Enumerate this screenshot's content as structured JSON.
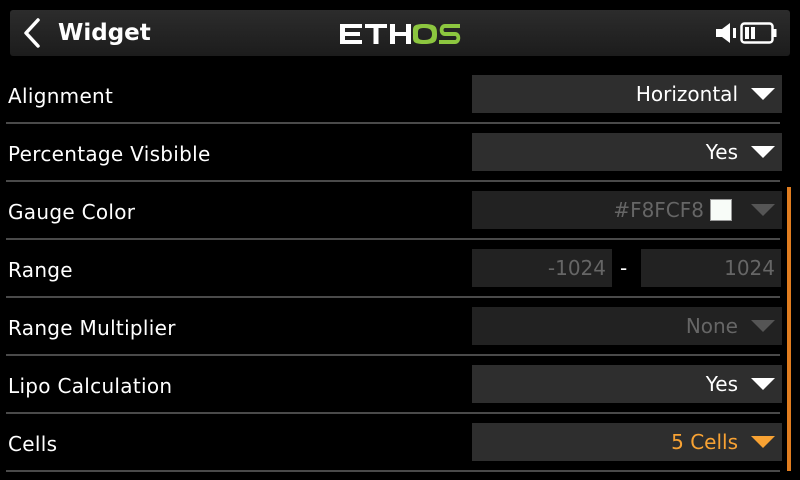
{
  "header": {
    "title": "Widget",
    "logo_text": "ETHOS"
  },
  "rows": [
    {
      "label": "Alignment",
      "value": "Horizontal"
    },
    {
      "label": "Percentage Visbible",
      "value": "Yes"
    },
    {
      "label": "Gauge Color",
      "value": "#F8FCF8",
      "swatch_color": "#F8FCF8"
    },
    {
      "label": "Range",
      "min": "-1024",
      "separator": "-",
      "max": "1024"
    },
    {
      "label": "Range Multiplier",
      "value": "None"
    },
    {
      "label": "Lipo Calculation",
      "value": "Yes"
    },
    {
      "label": "Cells",
      "value": "5 Cells"
    }
  ],
  "colors": {
    "accent": "#f8a233",
    "scrollbar": "#e07d20",
    "logo_green": "#8cc63f"
  }
}
